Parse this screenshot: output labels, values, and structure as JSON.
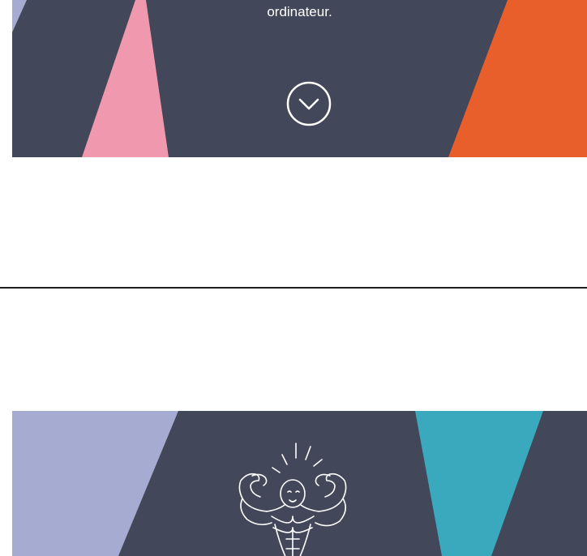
{
  "hero": {
    "caption": "ordinateur.",
    "scroll_icon": "chevron-down-circle-icon"
  },
  "feature": {
    "illustration": "flexing-bodybuilder-illustration"
  },
  "colors": {
    "background": "#424759",
    "lavender": "#a5abd1",
    "pink": "#f098ad",
    "orange": "#e85f2c",
    "teal": "#3aa9bd",
    "white": "#ffffff",
    "divider": "#1f1f1f"
  }
}
